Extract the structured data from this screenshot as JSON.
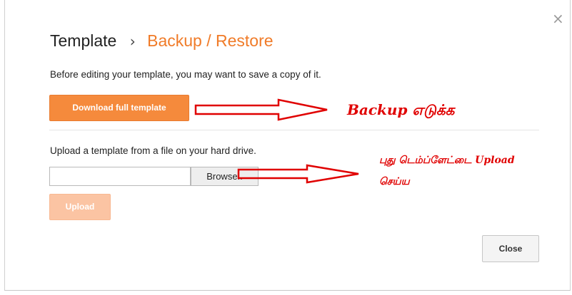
{
  "dialog": {
    "close_symbol": "×",
    "title": {
      "crumb": "Template",
      "separator": "›",
      "current": "Backup / Restore"
    },
    "description": "Before editing your template, you may want to save a copy of it.",
    "download_button": "Download full template",
    "upload_description": "Upload a template from a file on your hard drive.",
    "file_input": {
      "value": ""
    },
    "browse_button": "Browse..",
    "upload_button": "Upload",
    "close_button": "Close"
  },
  "annotations": {
    "backup": "Backup எடுக்க",
    "upload_line1": "புது டெம்ப்ளேட்டை Upload",
    "upload_line2": "செய்ய"
  },
  "colors": {
    "accent": "#f07b28",
    "download_button": "#f58a3c",
    "upload_button_disabled": "#fbc4a3",
    "annotation": "#e00000"
  },
  "icons": {
    "close": "close-icon",
    "arrows": "red-arrow-icon"
  }
}
